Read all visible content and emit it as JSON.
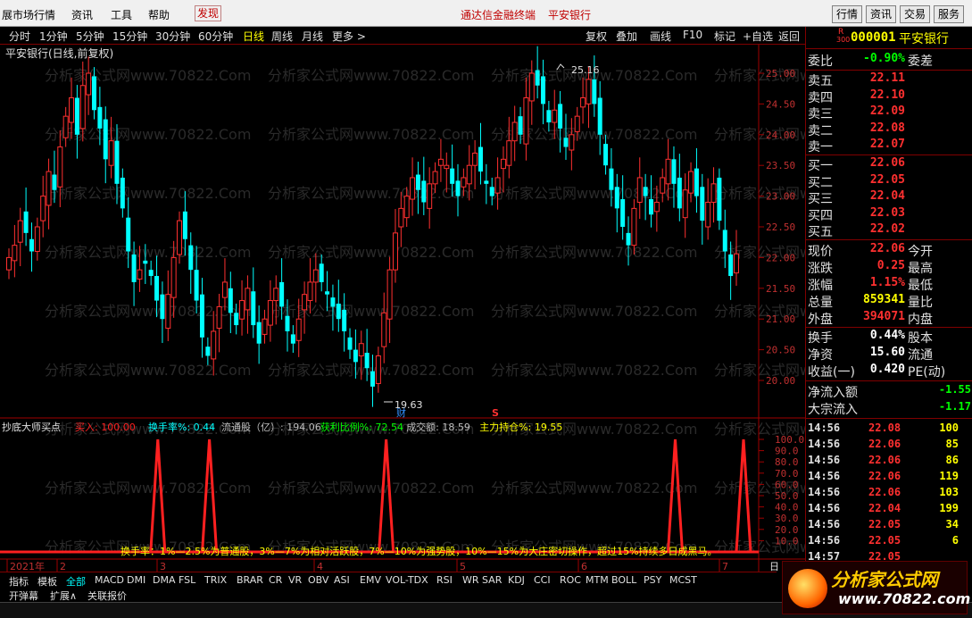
{
  "menu": {
    "items": [
      "展市场行情",
      "资讯",
      "工具",
      "帮助"
    ],
    "found": "发现",
    "center_title": "通达信金融终端",
    "center_stock": "平安银行",
    "right_buttons": [
      "行情",
      "资讯",
      "交易",
      "服务"
    ]
  },
  "toolbar": {
    "periods": [
      "分时",
      "1分钟",
      "5分钟",
      "15分钟",
      "30分钟",
      "60分钟",
      "日线",
      "周线",
      "月线",
      "更多 >"
    ],
    "active_period": "日线",
    "tools": [
      "复权",
      "叠加",
      "画线",
      "F10",
      "标记",
      "+自选",
      "返回"
    ]
  },
  "chart": {
    "title": "平安银行(日线,前复权)",
    "high_label": "25.16",
    "low_label": "19.63",
    "cai_label": "财",
    "s_label": "S",
    "watermark": "分析家公式网www.70822.Com",
    "price_ticks": [
      "25.00",
      "24.50",
      "24.00",
      "23.50",
      "23.00",
      "22.50",
      "22.00",
      "21.50",
      "21.00",
      "20.50",
      "20.00"
    ],
    "indicator_ticks": [
      "100.0",
      "90.0",
      "80.0",
      "70.0",
      "60.0",
      "50.0",
      "40.0",
      "30.0",
      "20.0",
      "10.0"
    ],
    "date_labels": [
      "2021年",
      "2",
      "3",
      "4",
      "5",
      "6",
      "7"
    ],
    "date_right": "日"
  },
  "chart_data": {
    "type": "candlestick",
    "ylim": [
      19.5,
      25.5
    ],
    "high": 25.16,
    "low": 19.63,
    "indicator": {
      "name": "抄底大师买点",
      "series": [
        {
          "name": "买入",
          "value": "100.00",
          "color": "#ff2020"
        },
        {
          "name": "换手率%",
          "value": "0.44",
          "color": "#00ffff"
        },
        {
          "name": "流通股（亿）",
          "value": "194.06",
          "color": "#c0c0c0"
        },
        {
          "name": "获利比例%",
          "value": "72.54",
          "color": "#00ff00"
        },
        {
          "name": "成交额",
          "value": "18.59",
          "color": "#c0c0c0"
        },
        {
          "name": "主力持仓%",
          "value": "19.55",
          "color": "#ffff00"
        }
      ],
      "ylim": [
        0,
        100
      ],
      "spikes_x_fraction": [
        0.208,
        0.276,
        0.509,
        0.89,
        0.98
      ]
    },
    "note": "换手率：1%—2.5%为普通股，3%—7%为相对活跃股，7%—10%为强势股，10%—15%为大庄密切操作，超过15%持续多日成黑马。"
  },
  "quote": {
    "r_label": "R",
    "r_num": "300",
    "code": "000001",
    "name": "平安银行",
    "weibi_label": "委比",
    "weibi_val": "-0.90%",
    "weicha_label": "委差",
    "sell": [
      {
        "label": "卖五",
        "price": "22.11"
      },
      {
        "label": "卖四",
        "price": "22.10"
      },
      {
        "label": "卖三",
        "price": "22.09"
      },
      {
        "label": "卖二",
        "price": "22.08"
      },
      {
        "label": "卖一",
        "price": "22.07"
      }
    ],
    "buy": [
      {
        "label": "买一",
        "price": "22.06"
      },
      {
        "label": "买二",
        "price": "22.05"
      },
      {
        "label": "买三",
        "price": "22.04"
      },
      {
        "label": "买四",
        "price": "22.03"
      },
      {
        "label": "买五",
        "price": "22.02"
      }
    ],
    "stats": [
      {
        "label": "现价",
        "value": "22.06",
        "label2": "今开",
        "color": "#ff3030"
      },
      {
        "label": "涨跌",
        "value": "0.25",
        "label2": "最高",
        "color": "#ff3030"
      },
      {
        "label": "涨幅",
        "value": "1.15%",
        "label2": "最低",
        "color": "#ff3030"
      },
      {
        "label": "总量",
        "value": "859341",
        "label2": "量比",
        "color": "#ffff00"
      },
      {
        "label": "外盘",
        "value": "394071",
        "label2": "内盘",
        "color": "#ff3030"
      }
    ],
    "stats2": [
      {
        "label": "换手",
        "value": "0.44%",
        "label2": "股本"
      },
      {
        "label": "净资",
        "value": "15.60",
        "label2": "流通"
      },
      {
        "label": "收益(一)",
        "value": "0.420",
        "label2": "PE(动)"
      }
    ],
    "flow": [
      {
        "label": "净流入额",
        "value": "-1.55"
      },
      {
        "label": "大宗流入",
        "value": "-1.17"
      }
    ],
    "ticks": [
      {
        "time": "14:56",
        "price": "22.08",
        "vol": "100"
      },
      {
        "time": "14:56",
        "price": "22.06",
        "vol": "85"
      },
      {
        "time": "14:56",
        "price": "22.06",
        "vol": "86"
      },
      {
        "time": "14:56",
        "price": "22.06",
        "vol": "119"
      },
      {
        "time": "14:56",
        "price": "22.06",
        "vol": "103"
      },
      {
        "time": "14:56",
        "price": "22.04",
        "vol": "199"
      },
      {
        "time": "14:56",
        "price": "22.05",
        "vol": "34"
      },
      {
        "time": "14:56",
        "price": "22.05",
        "vol": "6"
      },
      {
        "time": "14:57",
        "price": "22.05",
        "vol": ""
      }
    ]
  },
  "tabs": {
    "items": [
      "指标",
      "模板",
      "全部",
      "MACD",
      "DMI",
      "DMA",
      "FSL",
      "TRIX",
      "BRAR",
      "CR",
      "VR",
      "OBV",
      "ASI",
      "EMV",
      "VOL-TDX",
      "RSI",
      "WR",
      "SAR",
      "KDJ",
      "CCI",
      "ROC",
      "MTM",
      "BOLL",
      "PSY",
      "MCST"
    ],
    "selected": "全部",
    "row2": [
      "开弹幕",
      "扩展∧",
      "关联报价"
    ]
  },
  "logo": {
    "line1": "分析家公式网",
    "line2": "www.70822.com"
  }
}
